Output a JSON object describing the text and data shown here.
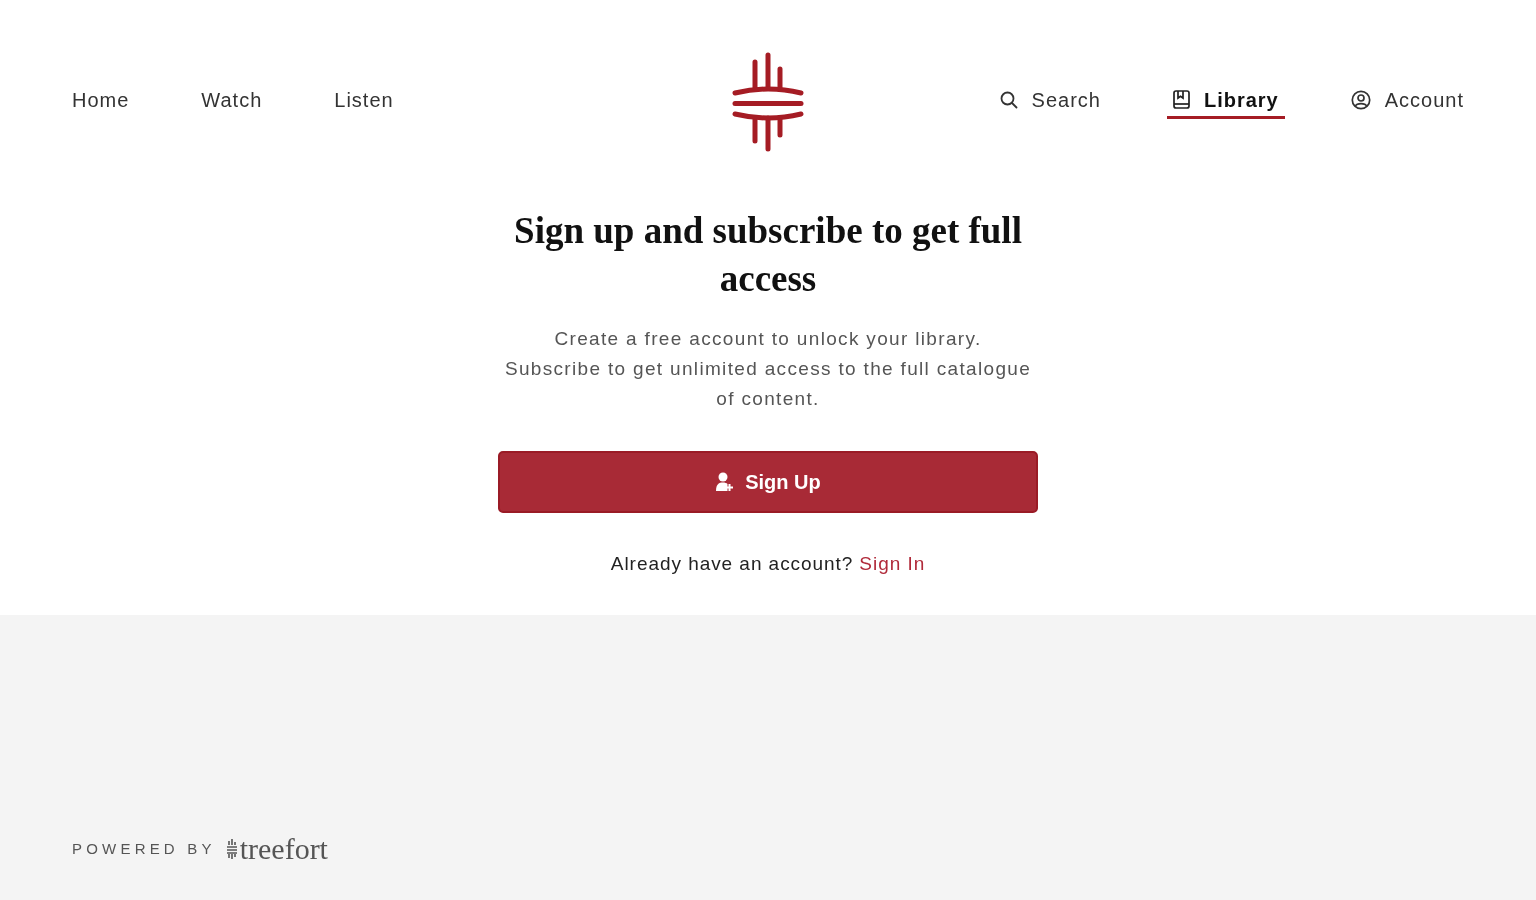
{
  "nav_left": [
    {
      "label": "Home",
      "selected": false
    },
    {
      "label": "Watch",
      "selected": false
    },
    {
      "label": "Listen",
      "selected": false
    }
  ],
  "nav_right": [
    {
      "kind": "search",
      "label": "Search",
      "selected": false
    },
    {
      "kind": "library",
      "label": "Library",
      "selected": true
    },
    {
      "kind": "account",
      "label": "Account",
      "selected": false
    }
  ],
  "heading": "Sign up and subscribe to get full access",
  "description": [
    "Create a free account to unlock your library.",
    "Subscribe to get unlimited access to the full catalogue of content."
  ],
  "signup_button": {
    "label": "Sign Up"
  },
  "signin_prompt": {
    "text": "Already have an account?",
    "link": "Sign In"
  },
  "footer": {
    "powered_by": "POWERED BY",
    "brand": "treefort"
  }
}
